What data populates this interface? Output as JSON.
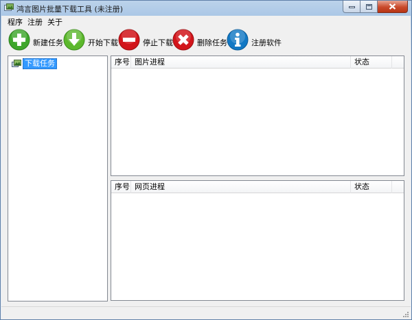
{
  "window": {
    "title": "鸿言图片批量下载工具 (未注册)"
  },
  "menu": {
    "items": [
      "程序",
      "注册",
      "关于"
    ]
  },
  "toolbar": {
    "new_task": "新建任务",
    "start_download": "开始下载",
    "stop_download": "停止下载",
    "delete_task": "删除任务",
    "register": "注册软件"
  },
  "colors": {
    "green": "#3ea62b",
    "red": "#d2151b",
    "blue": "#1278c4",
    "selection": "#3399ff"
  },
  "tree": {
    "root_label": "下载任务"
  },
  "image_list": {
    "columns": [
      "序号",
      "图片进程",
      "状态"
    ],
    "rows": []
  },
  "page_list": {
    "columns": [
      "序号",
      "网页进程",
      "状态"
    ],
    "rows": []
  },
  "statusbar": {
    "text": ""
  }
}
